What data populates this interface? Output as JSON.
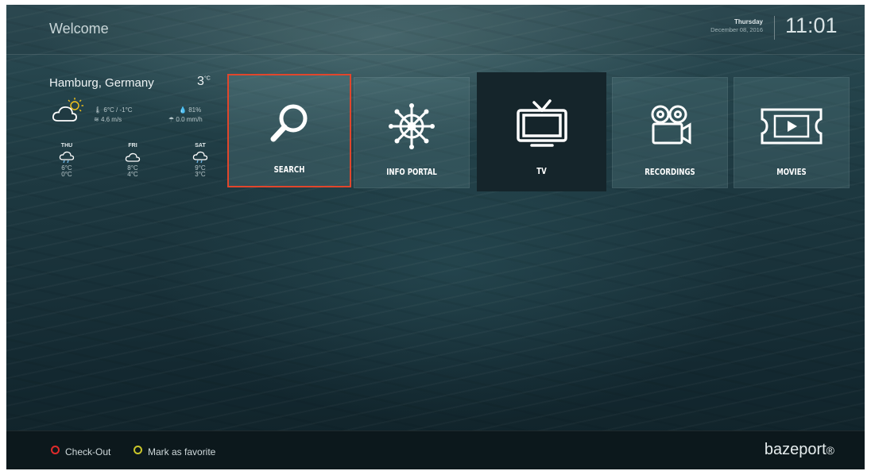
{
  "header": {
    "welcome": "Welcome",
    "day": "Thursday",
    "date": "December 08, 2016",
    "time": "11:01"
  },
  "weather": {
    "city": "Hamburg, Germany",
    "temp": "3",
    "temp_unit": "°C",
    "current_icon": "cloud-sun-icon",
    "range": "6°C / -1°C",
    "wind": "4.6 m/s",
    "humidity": "81%",
    "rain": "0.0 mm/h",
    "forecast": [
      {
        "day": "THU",
        "icon": "cloud-rain-icon",
        "high": "6°C",
        "low": "0°C"
      },
      {
        "day": "FRI",
        "icon": "cloud-icon",
        "high": "8°C",
        "low": "4°C"
      },
      {
        "day": "SAT",
        "icon": "cloud-rain-icon",
        "high": "9°C",
        "low": "3°C"
      }
    ]
  },
  "menu": {
    "tiles": [
      {
        "label": "SEARCH",
        "icon": "magnifier-icon",
        "state": "selected"
      },
      {
        "label": "INFO PORTAL",
        "icon": "ship-wheel-icon",
        "state": "normal"
      },
      {
        "label": "TV",
        "icon": "tv-icon",
        "state": "active"
      },
      {
        "label": "RECORDINGS",
        "icon": "camera-icon",
        "state": "normal"
      },
      {
        "label": "MOVIES",
        "icon": "ticket-play-icon",
        "state": "normal"
      }
    ]
  },
  "footer": {
    "checkout_label": "Check-Out",
    "favorite_label": "Mark as favorite",
    "checkout_color": "#e02b2b",
    "favorite_color": "#c9c52a",
    "brand": "bazeport",
    "brand_suffix": "®"
  },
  "colors": {
    "selection_border": "#e1462c",
    "active_tile": "#15252b"
  }
}
